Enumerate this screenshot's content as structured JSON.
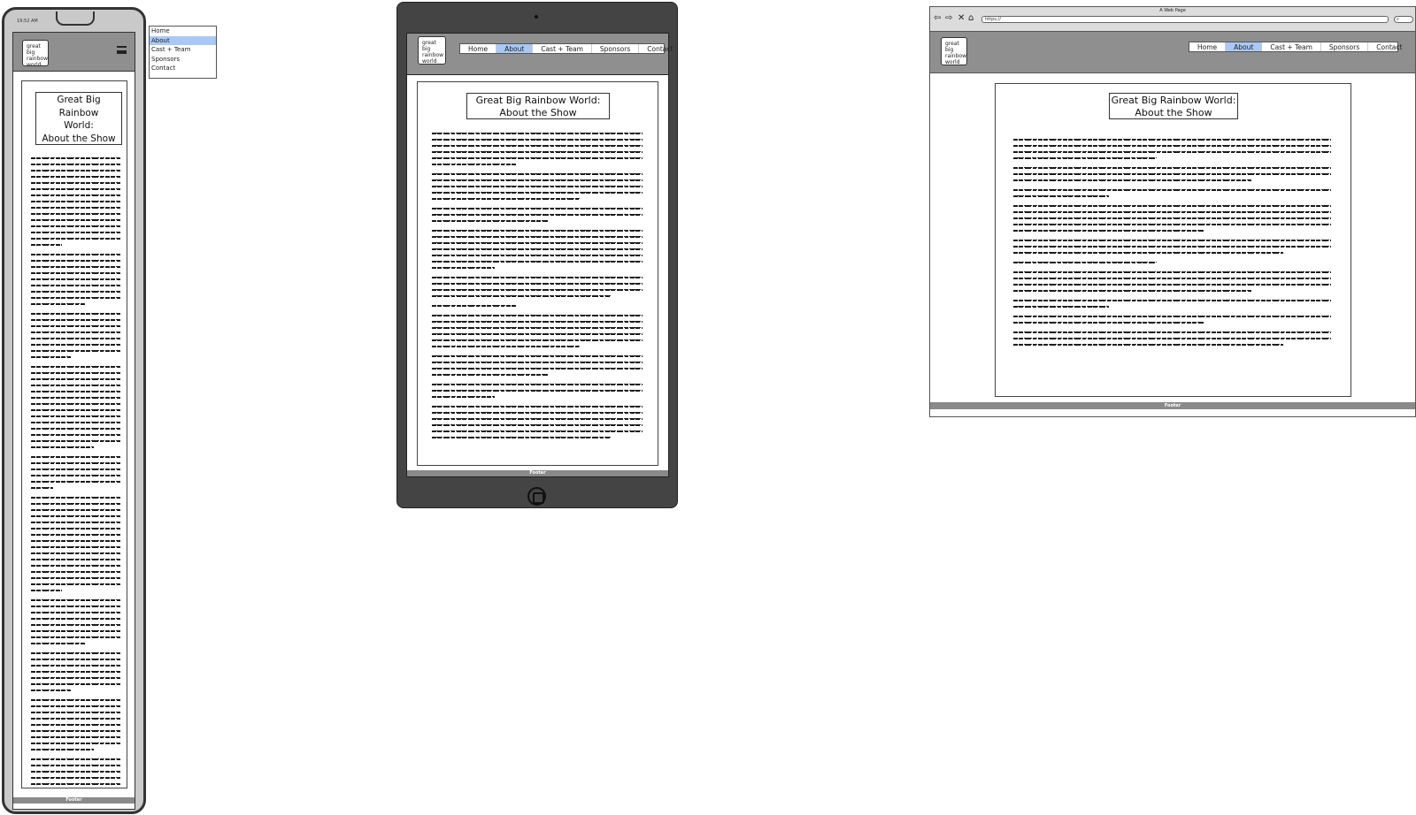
{
  "logo_text": [
    "great",
    "big",
    "rainbow",
    "world"
  ],
  "nav": {
    "items": [
      "Home",
      "About",
      "Cast + Team",
      "Sponsors",
      "Contact"
    ],
    "active": "About"
  },
  "page_title": "Great Big Rainbow World: About the Show",
  "footer_label": "Footer",
  "phone": {
    "status_time": "19:52 AM",
    "title_lines": [
      "Great Big",
      "Rainbow",
      "World:",
      "About the Show"
    ]
  },
  "tablet": {
    "title_lines": [
      "Great Big Rainbow World:",
      "About the Show"
    ]
  },
  "browser": {
    "window_title": "A Web Page",
    "url": "https://",
    "title_lines": [
      "Great Big Rainbow World:",
      "About the Show"
    ]
  },
  "colors": {
    "header_gray": "#8f8f8f",
    "active_nav": "#a9c8f5",
    "device_dark": "#444444"
  }
}
